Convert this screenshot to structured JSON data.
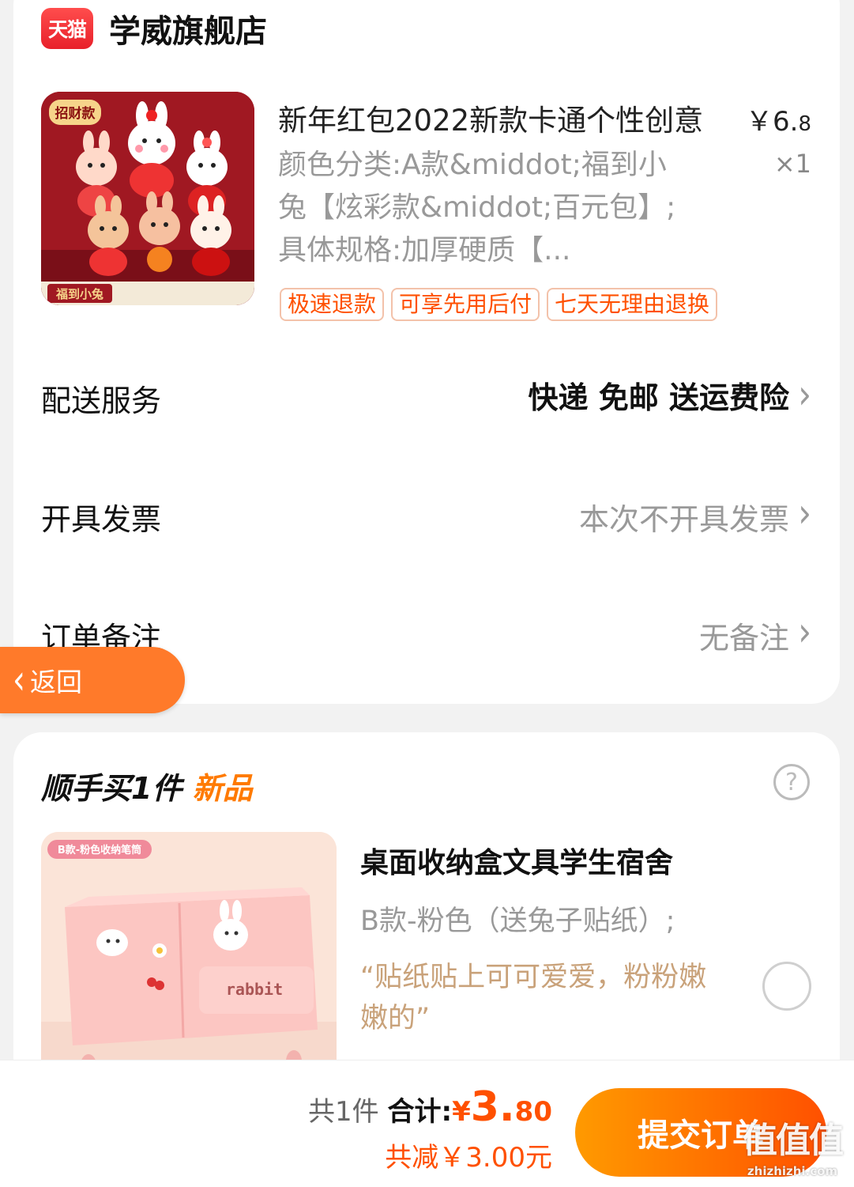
{
  "store": {
    "logo_text": "天猫",
    "name": "学威旗舰店"
  },
  "product": {
    "image_badge": "福到小兔",
    "image_top_badge": "招财款",
    "title": "新年红包2022新款卡通个性创意",
    "price_main": "￥6.",
    "price_decimal": "8",
    "quantity": "×1",
    "spec": "颜色分类:A款&middot;福到小兔【炫彩款&middot;百元包】;具体规格:加厚硬质【...",
    "tags": [
      "极速退款",
      "可享先用后付",
      "七天无理由退换"
    ]
  },
  "rows": {
    "delivery": {
      "label": "配送服务",
      "value": "快递 免邮 送运费险"
    },
    "invoice": {
      "label": "开具发票",
      "value": "本次不开具发票"
    },
    "remark": {
      "label": "订单备注",
      "value": "无备注"
    }
  },
  "back_button": {
    "label": "返回"
  },
  "add_on": {
    "header_prefix": "顺手买1件",
    "header_highlight": "新品",
    "help_icon": "?",
    "item": {
      "image_badge": "B款-粉色收纳笔筒",
      "image_text": "rabbit",
      "title": "桌面收纳盒文具学生宿舍",
      "spec": "B款-粉色（送兔子贴纸）;",
      "quote": "“贴纸贴上可可爱爱，粉粉嫩嫩的”"
    }
  },
  "footer": {
    "count": "共1件",
    "total_label": "合计:",
    "currency": "¥",
    "total_int": "3.",
    "total_dec": "80",
    "saved": "共减￥3.00元",
    "submit": "提交订单"
  },
  "watermark": {
    "main": "值值值",
    "sub": "zhizhizhi.com"
  },
  "colors": {
    "accent": "#ff5000",
    "orange": "#ff7a2a",
    "tmall_red": "#e8202a"
  }
}
